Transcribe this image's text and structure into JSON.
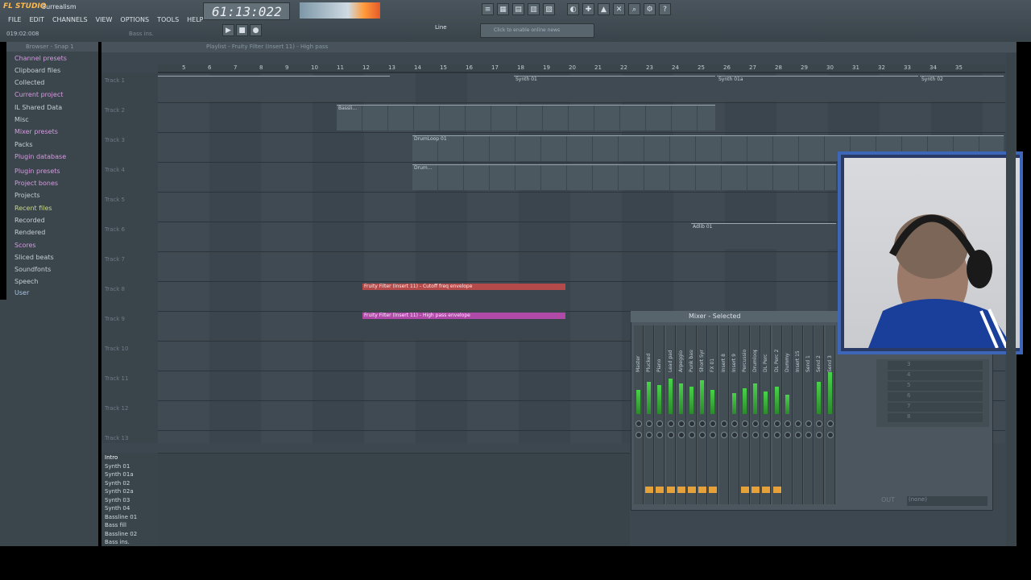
{
  "app": {
    "brand": "FL STUDIO",
    "project": "Surrealism",
    "time_position": "019:02:008",
    "hint": "Bass ins."
  },
  "menu": [
    "FILE",
    "EDIT",
    "CHANNELS",
    "VIEW",
    "OPTIONS",
    "TOOLS",
    "HELP"
  ],
  "transport": {
    "time": "61:13:022",
    "snap_mode": "Line",
    "news": "Click to enable online news"
  },
  "browser": {
    "title": "Browser - Snap 1",
    "items": [
      "Channel presets",
      "Clipboard files",
      "Collected",
      "Current project",
      "IL Shared Data",
      "Misc",
      "Mixer presets",
      "Packs",
      "Plugin database",
      "Plugin presets",
      "Project bones",
      "Projects",
      "Recent files",
      "Recorded",
      "Rendered",
      "Scores",
      "Sliced beats",
      "Soundfonts",
      "Speech",
      "User"
    ]
  },
  "playlist": {
    "title": "Playlist - Fruity Filter (Insert 11) - High pass",
    "ruler": [
      "5",
      "6",
      "7",
      "8",
      "9",
      "10",
      "11",
      "12",
      "13",
      "14",
      "15",
      "16",
      "17",
      "18",
      "19",
      "20",
      "21",
      "22",
      "23",
      "24",
      "25",
      "26",
      "27",
      "28",
      "29",
      "30",
      "31",
      "32",
      "33",
      "34",
      "35"
    ],
    "tracks": [
      "Track 1",
      "Track 2",
      "Track 3",
      "Track 4",
      "Track 5",
      "Track 6",
      "Track 7",
      "Track 8",
      "Track 9",
      "Track 10",
      "Track 11",
      "Track 12",
      "Track 13"
    ],
    "clips": {
      "synth1": "Synth 01",
      "synth1a": "Synth 01a",
      "synth2": "Synth 02",
      "bass": "Bassli...",
      "drum": "DrumLoop 01",
      "drum_short": "Drum...",
      "adlib": "Adlib 01",
      "auto_cutoff": "Fruity Filter (Insert 11) - Cutoff freq envelope",
      "auto_hp": "Fruity Filter (Insert 11) - High pass envelope"
    }
  },
  "patterns": [
    "Intro",
    "Synth 01",
    "Synth 01a",
    "Synth 02",
    "Synth 02a",
    "Synth 03",
    "Synth 04",
    "Bassline 01",
    "Bass fill",
    "Bassline 02",
    "Bass ins."
  ],
  "mixer": {
    "title": "Mixer - Selected",
    "channels": [
      "Master",
      "Plucked",
      "Piano",
      "Lead pad",
      "Arpeggio",
      "Punk bass",
      "Short Synth",
      "FX 01",
      "Insert 8",
      "Insert 9",
      "Percussion",
      "Drumloop",
      "DL Perc",
      "DL Perc 2",
      "Dummy",
      "Insert 15",
      "Send 1",
      "Send 2",
      "Send 3"
    ],
    "slots": [
      "3",
      "4",
      "5",
      "6",
      "7",
      "8"
    ],
    "out": "OUT",
    "out_value": "(none)"
  }
}
